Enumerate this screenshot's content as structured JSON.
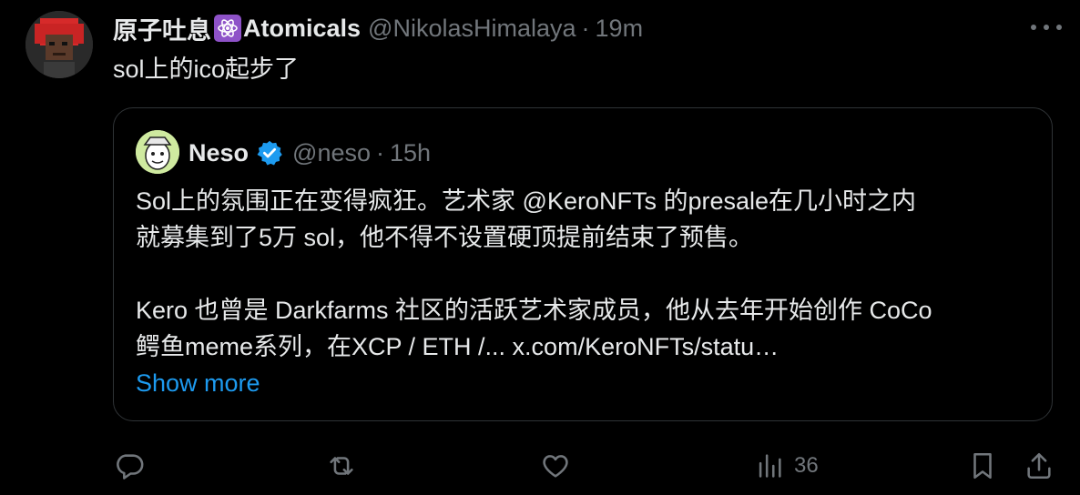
{
  "tweet": {
    "author_name": "原子吐息",
    "author_name_suffix": "Atomicals",
    "handle": "@NikolasHimalaya",
    "separator": "·",
    "time": "19m",
    "text": "sol上的ico起步了"
  },
  "quoted": {
    "name": "Neso",
    "handle": "@neso",
    "separator": "·",
    "time": "15h",
    "line1": "Sol上的氛围正在变得疯狂。艺术家 @KeroNFTs  的presale在几小时之内",
    "line2": "就募集到了5万 sol，他不得不设置硬顶提前结束了预售。",
    "line3": "Kero 也曾是 Darkfarms 社区的活跃艺术家成员，他从去年开始创作 CoCo",
    "line4": "鳄鱼meme系列，在XCP / ETH /... x.com/KeroNFTs/statu…",
    "show_more": "Show more"
  },
  "actions": {
    "views_count": "36"
  },
  "icons": [
    "more-icon",
    "atom-icon",
    "verified-badge-icon",
    "reply-icon",
    "retweet-icon",
    "like-icon",
    "views-icon",
    "bookmark-icon",
    "share-icon"
  ],
  "colors": {
    "background": "#000000",
    "text": "#e7e9ea",
    "muted": "#71767b",
    "link": "#1d9bf0",
    "border": "#2f3336",
    "verified": "#1d9bf0",
    "atom_badge": "#8e52c8"
  }
}
